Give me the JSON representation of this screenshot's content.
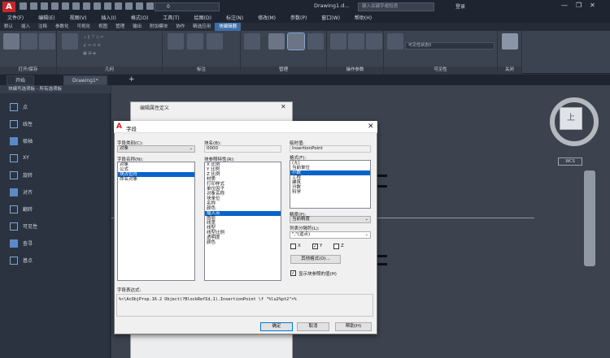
{
  "app": {
    "logo_letter": "A",
    "layer_value": "0",
    "doc_title": "Drawing1.d...",
    "search_placeholder": "键入关键字或短语",
    "login_label": "登录"
  },
  "menus": [
    "文件(F)",
    "编辑(E)",
    "视图(V)",
    "插入(I)",
    "格式(O)",
    "工具(T)",
    "绘图(D)",
    "标注(N)",
    "修改(M)",
    "参数(P)",
    "窗口(W)",
    "帮助(H)"
  ],
  "ribbon_tabs": [
    {
      "label": "默认",
      "active": false
    },
    {
      "label": "插入",
      "active": false
    },
    {
      "label": "注释",
      "active": false
    },
    {
      "label": "参数化",
      "active": false
    },
    {
      "label": "可视化",
      "active": false
    },
    {
      "label": "视图",
      "active": false
    },
    {
      "label": "管理",
      "active": false
    },
    {
      "label": "输出",
      "active": false
    },
    {
      "label": "附加模块",
      "active": false
    },
    {
      "label": "协作",
      "active": false
    },
    {
      "label": "精选应用",
      "active": false
    },
    {
      "label": "块编辑器",
      "active": true
    }
  ],
  "ribbon_panels": {
    "open_save": "打开/保存",
    "geometry": "几何",
    "dimension": "标注",
    "manage": "管理",
    "action_params": "操作参数",
    "visibility": "可见性",
    "close": "关闭",
    "visibility_state": "可见性状态0",
    "close_label": "关闭"
  },
  "doc_tabs": {
    "start": "开始",
    "drawing": "Drawing1*"
  },
  "palette": {
    "header": "块编写选项板 - 所有选项板",
    "items": [
      "点",
      "线性",
      "极轴",
      "XY",
      "旋转",
      "对齐",
      "翻转",
      "可见性",
      "查寻",
      "基点"
    ]
  },
  "viewcube": {
    "face": "上",
    "wcs": "WCS"
  },
  "behind_dialog": {
    "title": "编辑属性定义"
  },
  "dialog": {
    "title": "字段",
    "field_category_label": "字段类别(C):",
    "field_category_value": "对象",
    "field_names_label": "字段名称(N):",
    "field_names": [
      "对象",
      "公式",
      "块占位符",
      "命名对象"
    ],
    "field_names_selected": 2,
    "block_name_label": "块名(B):",
    "block_name_value": "0000",
    "block_ref_prop_label": "块参照特性(R):",
    "block_ref_props": [
      "X 比例",
      "Y 比例",
      "Z 比例",
      "材质",
      "打印样式",
      "单位因子",
      "对象名称",
      "块单位",
      "名称",
      "颜色",
      "插入点",
      "图层",
      "线宽",
      "线型",
      "线型比例",
      "透明度",
      "颜色"
    ],
    "block_ref_props_selected": 10,
    "temp_value_label": "临时值:",
    "temp_value": "InsertionPoint",
    "format_label": "格式(F):",
    "formats": [
      "(无)",
      "当前单位",
      "小数",
      "工程",
      "建筑",
      "分数",
      "科学"
    ],
    "formats_selected": 2,
    "precision_label": "精度(P):",
    "precision_value": "当前精度",
    "list_sep_label": "列表分隔符(L):",
    "list_sep_value": "\",\"(逗点)",
    "chk_x": "X",
    "chk_y": "Y",
    "chk_z": "Z",
    "other_format_button": "其他格式(O)...",
    "show_default_label": "显示块参照的值(H)",
    "expression_label": "字段表达式:",
    "expression": "%<\\AcObjProp.16.2 Object(?BlockRefId,1).InsertionPoint \\f \"%lu2%pt2\">%",
    "ok_button": "确定",
    "cancel_button": "取消",
    "help_button": "帮助(H)"
  }
}
